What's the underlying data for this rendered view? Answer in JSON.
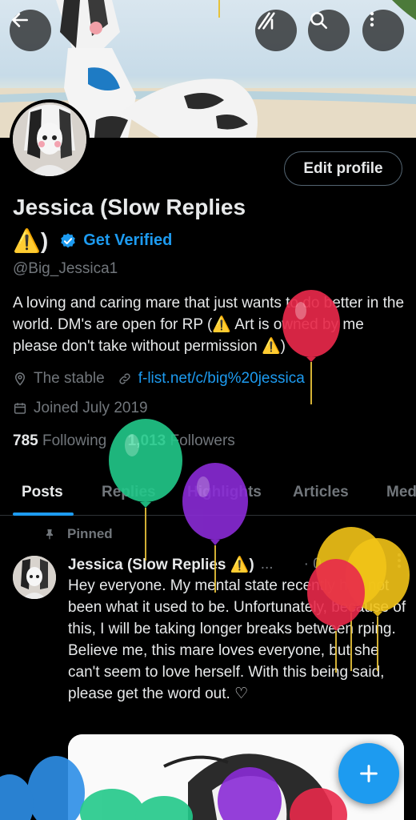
{
  "header": {
    "back_icon": "arrow-left-icon",
    "grok_icon": "grok-icon",
    "search_icon": "search-icon",
    "more_icon": "vertical-ellipsis-icon"
  },
  "profile": {
    "edit_label": "Edit profile",
    "name_line1": "Jessica (Slow Replies",
    "name_line2_emoji": "⚠️",
    "name_line2_paren": ")",
    "get_verified": "Get Verified",
    "handle": "@Big_Jessica1",
    "bio": "A loving and caring mare that just wants to do better in the world. DM's are open for RP (⚠️ Art is owned by me please don't take without permission ⚠️)",
    "location": "The stable",
    "website": "f-list.net/c/big%20jessica",
    "joined": "Joined July 2019",
    "following_count": "785",
    "following_label": "Following",
    "followers_count": "1,013",
    "followers_label": "Followers"
  },
  "tabs": [
    "Posts",
    "Replies",
    "Highlights",
    "Articles",
    "Media"
  ],
  "tabs_visible": [
    "Posts",
    "Replies",
    "Highlights",
    "Articles",
    "Med"
  ],
  "pinned_post": {
    "pinned_label": "Pinned",
    "author": "Jessica (Slow Replies ⚠️)",
    "ellipsis": "...",
    "time": "· 0",
    "text": "Hey everyone. My mental state recently has not been what it used to be. Unfortunately, because of this, I will be taking longer breaks between rping. Believe me, this mare loves everyone, but she can't seem to love herself. With this being said, please get the word out. ♡"
  },
  "fab_icon": "plus-icon",
  "colors": {
    "accent": "#1d9bf0",
    "background": "#000000",
    "text": "#e7e9ea",
    "muted": "#71767b"
  }
}
